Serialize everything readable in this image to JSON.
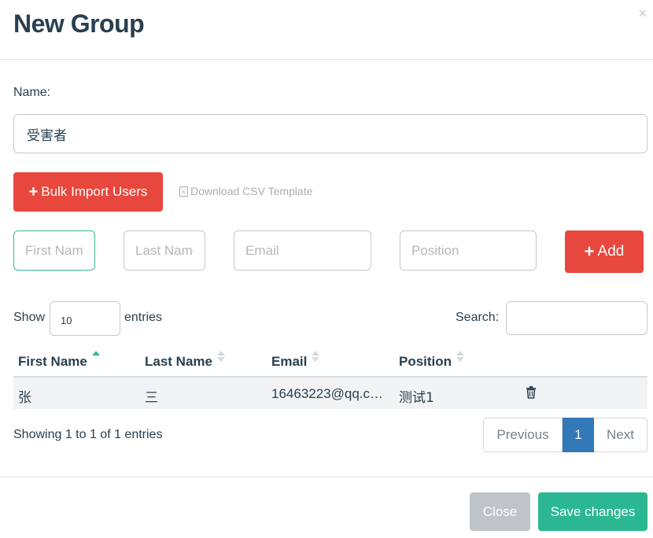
{
  "modal": {
    "title": "New Group",
    "close_glyph": "×"
  },
  "name": {
    "label": "Name:",
    "value": "受害者"
  },
  "actions": {
    "bulk_import_label": "Bulk Import Users",
    "download_csv_label": "Download CSV Template"
  },
  "new_user": {
    "first_name_placeholder": "First Name",
    "last_name_placeholder": "Last Name",
    "email_placeholder": "Email",
    "position_placeholder": "Position",
    "add_label": "Add"
  },
  "table_controls": {
    "show_label": "Show",
    "entries_value": "10",
    "entries_label": "entries",
    "search_label": "Search:"
  },
  "table": {
    "columns": [
      "First Name",
      "Last Name",
      "Email",
      "Position"
    ],
    "rows": [
      {
        "first_name": "张",
        "last_name": "三",
        "email": "16463223@qq.c…",
        "position": "测试1"
      }
    ]
  },
  "pagination": {
    "info": "Showing 1 to 1 of 1 entries",
    "previous": "Previous",
    "current_page": "1",
    "next": "Next"
  },
  "footer": {
    "close_label": "Close",
    "save_label": "Save changes"
  },
  "colors": {
    "primary_red": "#e8473d",
    "accent_green": "#2bb792",
    "page_blue": "#3378b7",
    "text": "#283f50"
  }
}
